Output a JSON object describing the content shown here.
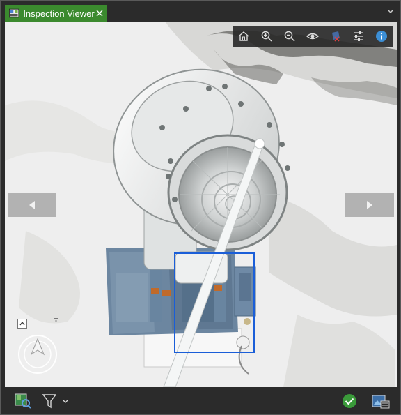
{
  "window": {
    "tab_title": "Inspection Viewer",
    "accent_color": "#3b8a2e",
    "tab_icon": "inspection-viewer-icon",
    "close_icon": "close-icon",
    "menu_icon": "chevron-down-icon"
  },
  "toolbar": {
    "buttons": [
      {
        "name": "home-icon",
        "tooltip": "Home"
      },
      {
        "name": "zoom-in-icon",
        "tooltip": "Zoom In"
      },
      {
        "name": "zoom-out-icon",
        "tooltip": "Zoom Out"
      },
      {
        "name": "eye-icon",
        "tooltip": "Visibility"
      },
      {
        "name": "footprint-icon",
        "tooltip": "Footprint"
      },
      {
        "name": "adjust-sliders-icon",
        "tooltip": "Adjust"
      },
      {
        "name": "info-icon",
        "tooltip": "Information"
      }
    ]
  },
  "viewer": {
    "prev_icon": "arrow-left-icon",
    "next_icon": "arrow-right-icon",
    "selection_color": "#1a5ed8",
    "compass_icon": "compass-icon"
  },
  "bottom": {
    "left_icons": [
      "image-search-icon",
      "filter-icon",
      "chevron-down-icon"
    ],
    "right_icons": [
      "checkmark-icon",
      "image-properties-icon"
    ],
    "status_color": "#3a9a3a"
  }
}
